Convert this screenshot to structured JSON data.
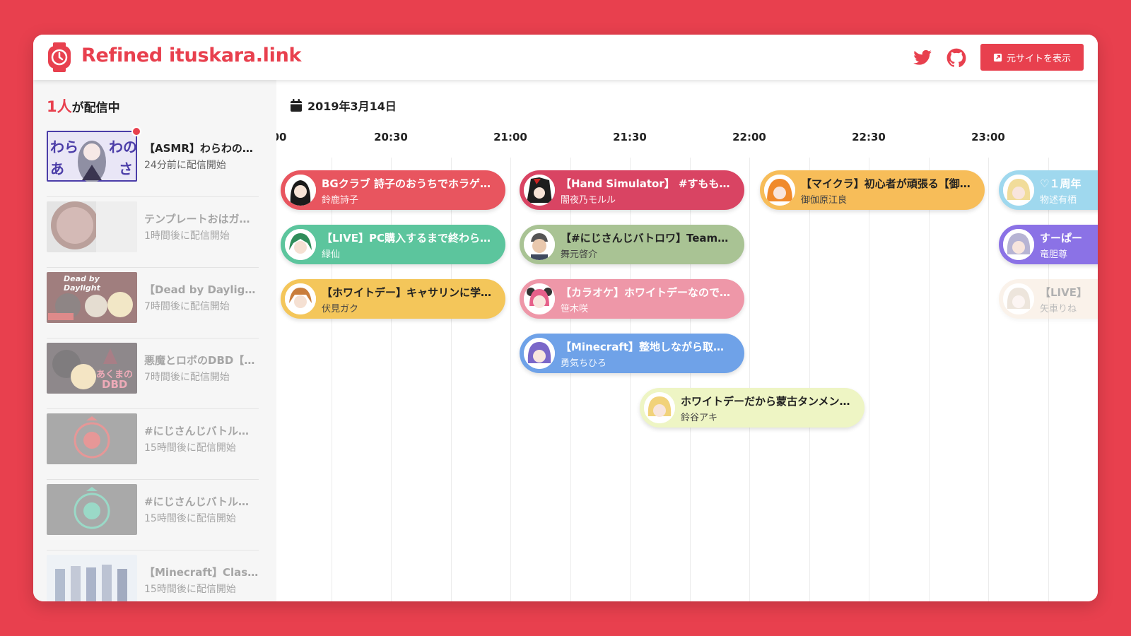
{
  "app": {
    "brand": "Refined ituskara.link",
    "original_site_label": "元サイトを表示",
    "accent": "#e8404e"
  },
  "sidebar": {
    "live_count": "1人",
    "live_suffix": "が配信中",
    "items": [
      {
        "title": "【ASMR】わらわの…",
        "time": "24分前に配信開始",
        "live": true
      },
      {
        "title": "テンプレートおはガ…",
        "time": "1時間後に配信開始",
        "live": false
      },
      {
        "title": "【Dead by Daylight…",
        "time": "7時間後に配信開始",
        "live": false
      },
      {
        "title": "悪魔とロボのDBD【…",
        "time": "7時間後に配信開始",
        "live": false
      },
      {
        "title": "#にじさんじバトル…",
        "time": "15時間後に配信開始",
        "live": false
      },
      {
        "title": "#にじさんじバトル…",
        "time": "15時間後に配信開始",
        "live": false
      },
      {
        "title": "【Minecraft】Class…",
        "time": "15時間後に配信開始",
        "live": false
      }
    ],
    "thumb_text": {
      "t1": [
        "わら",
        "わの",
        "あ",
        "さ"
      ],
      "t3": "Dead by Daylight",
      "t4": [
        "あくまの",
        "DBD"
      ]
    }
  },
  "timeline": {
    "date": "2019年3月14日",
    "hours": [
      "00",
      "20:30",
      "21:00",
      "21:30",
      "22:00",
      "22:30",
      "23:00"
    ],
    "blocks": [
      {
        "title": "BGクラブ 詩子のおうちでホラゲ…",
        "name": "鈴鹿詩子",
        "color": "#e8555f"
      },
      {
        "title": "【LIVE】PC購入するまで終わら…",
        "name": "緑仙",
        "color": "#5cc59d"
      },
      {
        "title": "【ホワイトデー】キャサリンに学…",
        "name": "伏見ガク",
        "color": "#f4c65a"
      },
      {
        "title": "【Hand Simulator】 #すももる …",
        "name": "闇夜乃モルル",
        "color": "#d94463"
      },
      {
        "title": "【#にじさんじバトロワ】TeamA …",
        "name": "舞元啓介",
        "color": "#a9c394"
      },
      {
        "title": "【カラオケ】ホワイトデーなので…",
        "name": "笹木咲",
        "color": "#ee97a8"
      },
      {
        "title": "【Minecraft】整地しながら取引…",
        "name": "勇気ちひろ",
        "color": "#6fa2e8"
      },
      {
        "title": "ホワイトデーだから蒙古タンメン…",
        "name": "鈴谷アキ",
        "color": "#eef5c4"
      },
      {
        "title": "【マイクラ】初心者が頑張る【御…",
        "name": "御伽原江良",
        "color": "#f7bd59"
      },
      {
        "title": "♡１周年",
        "name": "物述有栖",
        "color": "#9fd8ee"
      },
      {
        "title": "すーぱー",
        "name": "竜胆尊",
        "color": "#8b72e6"
      },
      {
        "title": "【LIVE】",
        "name": "矢車りね",
        "color": "#f2dcc6"
      }
    ]
  }
}
